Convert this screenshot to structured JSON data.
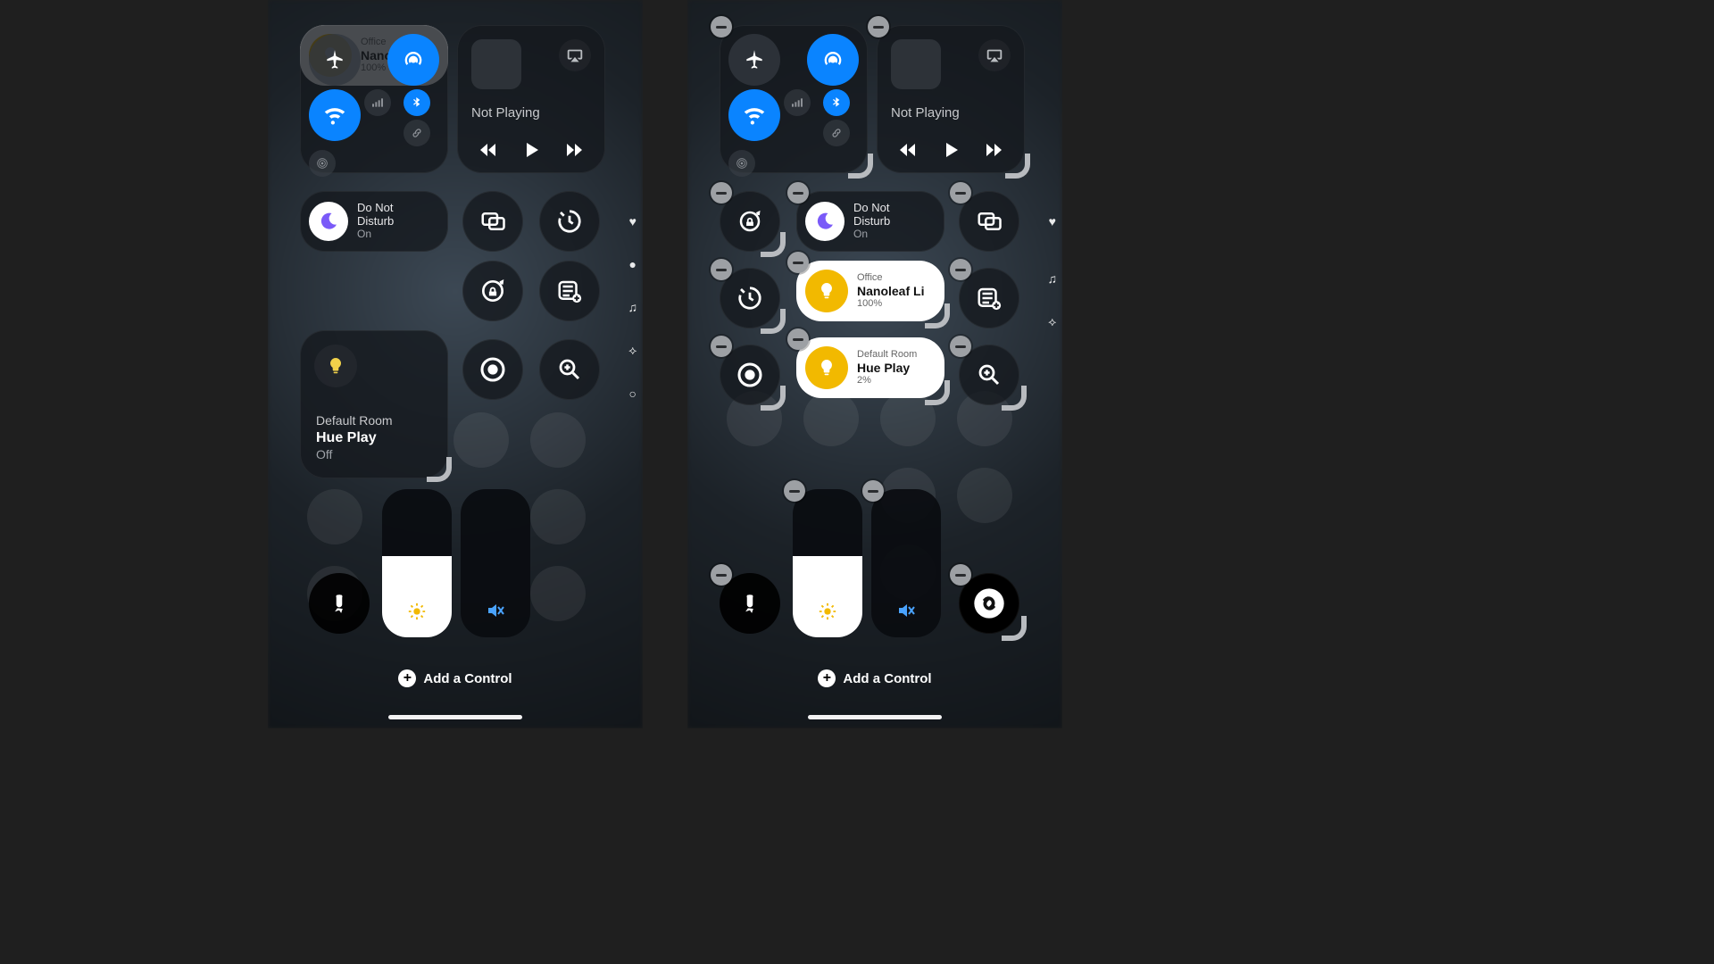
{
  "left": {
    "nowPlaying": {
      "status": "Not Playing"
    },
    "focus": {
      "title": "Do Not",
      "title2": "Disturb",
      "state": "On"
    },
    "nanoleaf": {
      "room": "Office",
      "name": "Nanoleaf Li",
      "level": "100%"
    },
    "huePlay": {
      "room": "Default Room",
      "name": "Hue Play",
      "state": "Off"
    },
    "brightnessPct": 55,
    "volumePct": 0,
    "addControl": "Add a Control"
  },
  "right": {
    "nowPlaying": {
      "status": "Not Playing"
    },
    "focus": {
      "title": "Do Not",
      "title2": "Disturb",
      "state": "On"
    },
    "nanoleaf": {
      "room": "Office",
      "name": "Nanoleaf Li",
      "level": "100%"
    },
    "huePlay": {
      "room": "Default Room",
      "name": "Hue Play",
      "level": "2%"
    },
    "brightnessPct": 55,
    "volumePct": 0,
    "addControl": "Add a Control"
  },
  "colors": {
    "accentBlue": "#0a84ff",
    "bulbYellow": "#f2b900"
  }
}
